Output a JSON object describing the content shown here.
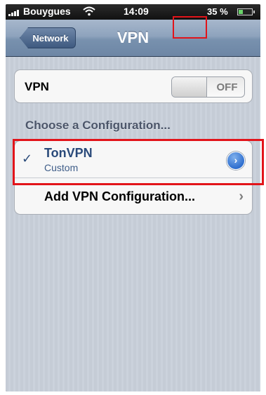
{
  "status_bar": {
    "carrier": "Bouygues",
    "time": "14:09",
    "battery_percent": "35 %",
    "battery_level": 0.35,
    "signal_icon": "signal-bars-icon",
    "wifi_icon": "wifi-icon",
    "battery_icon": "battery-icon"
  },
  "nav_bar": {
    "back_label": "Network",
    "title": "VPN"
  },
  "vpn_toggle": {
    "label": "VPN",
    "state": "OFF"
  },
  "configurations": {
    "section_header": "Choose a Configuration...",
    "selected": {
      "check_icon": "checkmark-icon",
      "name": "TonVPN",
      "type": "Custom",
      "detail_icon": "chevron-right-circle-icon"
    },
    "add_label": "Add VPN Configuration...",
    "add_chevron": "chevron-right-icon"
  },
  "annotations": {
    "highlight_color": "#e2141a"
  }
}
